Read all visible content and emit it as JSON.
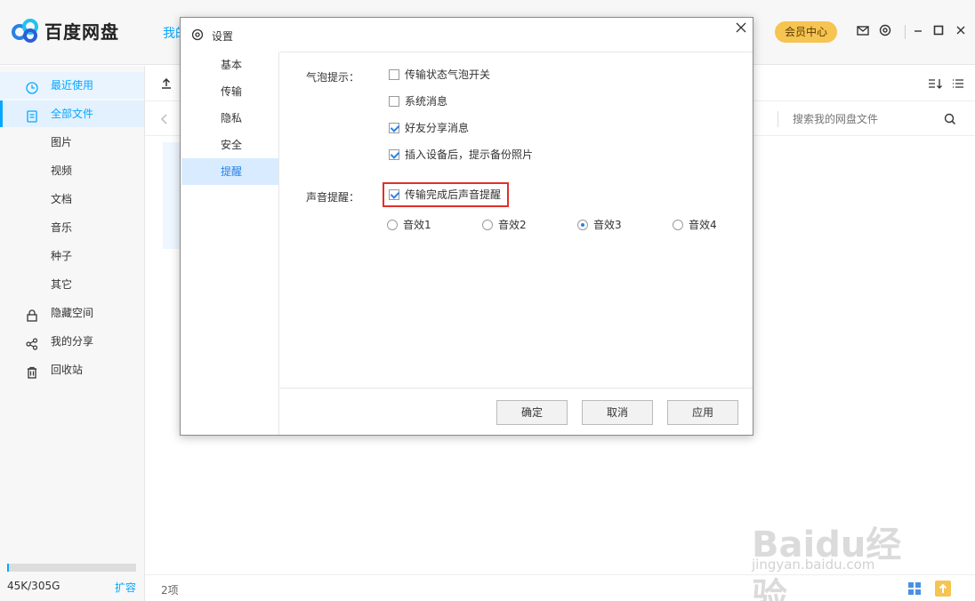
{
  "app": {
    "name": "百度网盘"
  },
  "header": {
    "tab_partial": "我的",
    "vip_label": "会员中心",
    "icons": [
      "mail-icon",
      "gear-icon",
      "minimize-icon",
      "maximize-icon",
      "close-icon"
    ]
  },
  "sidebar": {
    "items": [
      {
        "label": "最近使用",
        "icon": "clock-icon"
      },
      {
        "label": "全部文件",
        "icon": "file-icon"
      },
      {
        "label": "图片"
      },
      {
        "label": "视频"
      },
      {
        "label": "文档"
      },
      {
        "label": "音乐"
      },
      {
        "label": "种子"
      },
      {
        "label": "其它"
      },
      {
        "label": "隐藏空间",
        "icon": "lock-icon"
      },
      {
        "label": "我的分享",
        "icon": "share-icon"
      },
      {
        "label": "回收站",
        "icon": "trash-icon"
      }
    ],
    "storage": {
      "used_text": "45K/305G",
      "expand_label": "扩容",
      "used_fraction": 0.01
    }
  },
  "main": {
    "search_placeholder": "搜索我的网盘文件",
    "item_count": "2项"
  },
  "dialog": {
    "title": "设置",
    "tabs": [
      {
        "label": "基本"
      },
      {
        "label": "传输"
      },
      {
        "label": "隐私"
      },
      {
        "label": "安全"
      },
      {
        "label": "提醒",
        "active": true
      }
    ],
    "bubble_section": {
      "label": "气泡提示：",
      "options": [
        {
          "label": "传输状态气泡开关",
          "checked": false
        },
        {
          "label": "系统消息",
          "checked": false
        },
        {
          "label": "好友分享消息",
          "checked": true
        },
        {
          "label": "插入设备后，提示备份照片",
          "checked": true
        }
      ]
    },
    "sound_section": {
      "label": "声音提醒：",
      "checkbox": {
        "label": "传输完成后声音提醒",
        "checked": true
      },
      "radios": [
        {
          "label": "音效1",
          "checked": false
        },
        {
          "label": "音效2",
          "checked": false
        },
        {
          "label": "音效3",
          "checked": true
        },
        {
          "label": "音效4",
          "checked": false
        }
      ]
    },
    "buttons": {
      "ok": "确定",
      "cancel": "取消",
      "apply": "应用"
    }
  },
  "watermark": {
    "text": "Baidu经验",
    "sub": "jingyan.baidu.com"
  },
  "colors": {
    "accent": "#06a7ff",
    "vip": "#f5c451",
    "highlight": "#e0302a"
  }
}
